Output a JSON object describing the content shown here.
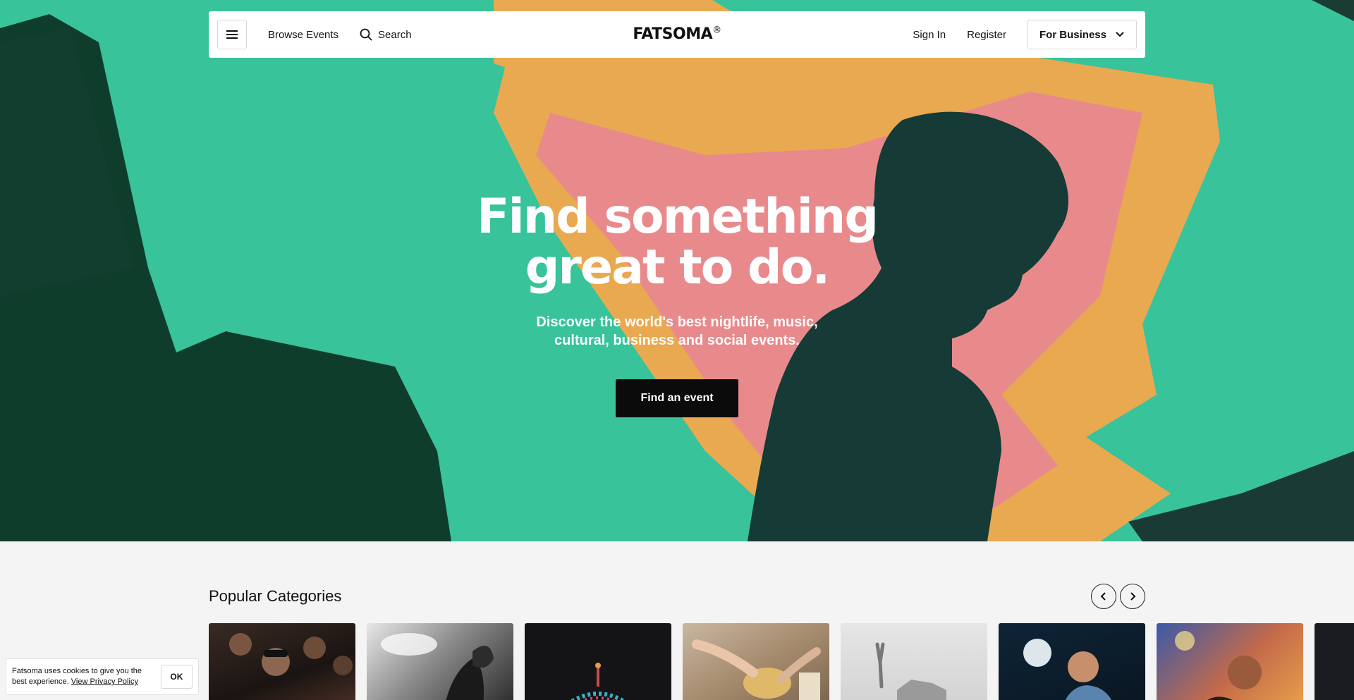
{
  "nav": {
    "browse_label": "Browse Events",
    "search_label": "Search",
    "logo_text": "FATSOMA",
    "logo_mark": "®",
    "signin_label": "Sign In",
    "register_label": "Register",
    "business_label": "For Business"
  },
  "hero": {
    "title_line1": "Find something",
    "title_line2": "great to do.",
    "subtitle_line1": "Discover the world's best nightlife, music,",
    "subtitle_line2": "cultural, business and social events.",
    "cta_label": "Find an event"
  },
  "categories": {
    "title": "Popular Categories"
  },
  "cookie": {
    "text": "Fatsoma uses cookies to give you the best experience.",
    "link_label": "View Privacy Policy",
    "ok_label": "OK"
  },
  "colors": {
    "hero_green": "#38c39b",
    "accent_pink": "#e88a8c",
    "accent_orange": "#e9a951",
    "button_dark": "#0b0b0b"
  }
}
